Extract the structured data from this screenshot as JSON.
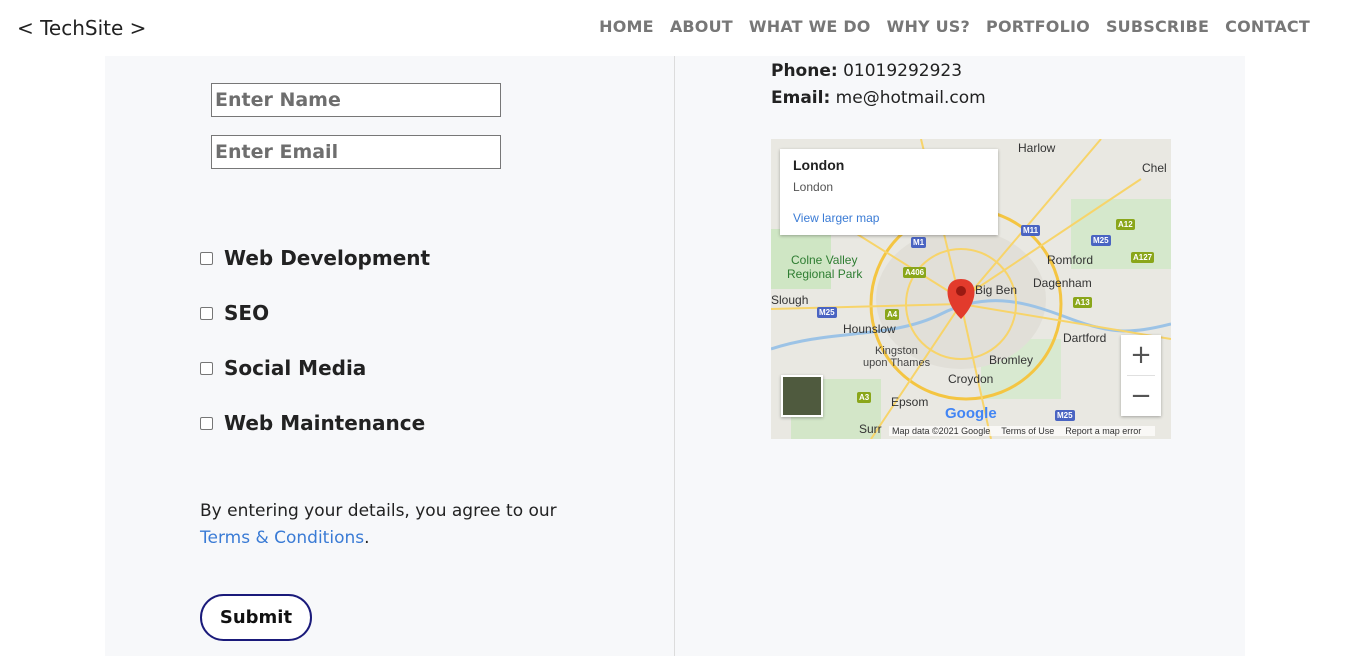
{
  "header": {
    "brand": "< TechSite >",
    "nav": [
      "HOME",
      "ABOUT",
      "WHAT WE DO",
      "WHY US?",
      "PORTFOLIO",
      "SUBSCRIBE",
      "CONTACT"
    ]
  },
  "form": {
    "name_placeholder": "Enter Name",
    "email_placeholder": "Enter Email",
    "services": [
      "Web Development",
      "SEO",
      "Social Media",
      "Web Maintenance"
    ],
    "agree_text": "By entering your details, you agree to our ",
    "terms_link": "Terms & Conditions",
    "agree_end": ".",
    "submit_label": "Submit"
  },
  "contact": {
    "phone_label": "Phone:",
    "phone": "01019292923",
    "email_label": "Email:",
    "email": "me@hotmail.com"
  },
  "map": {
    "card_title": "London",
    "card_subtitle": "London",
    "card_link": "View larger map",
    "places": [
      "Harlow",
      "Chel",
      "Colne Valley",
      "Regional Park",
      "Romford",
      "Dagenham",
      "Slough",
      "Big Ben",
      "Hounslow",
      "Dartford",
      "Kingston",
      "upon Thames",
      "Bromley",
      "Croydon",
      "Epsom",
      "Surr"
    ],
    "roads": [
      "M1",
      "M11",
      "M25",
      "A12",
      "A127",
      "A406",
      "A4",
      "M25",
      "A13",
      "A3",
      "M25"
    ],
    "attribution": [
      "Map data ©2021 Google",
      "Terms of Use",
      "Report a map error"
    ],
    "google_logo": "Google",
    "zoom_in": "+",
    "zoom_out": "−"
  }
}
